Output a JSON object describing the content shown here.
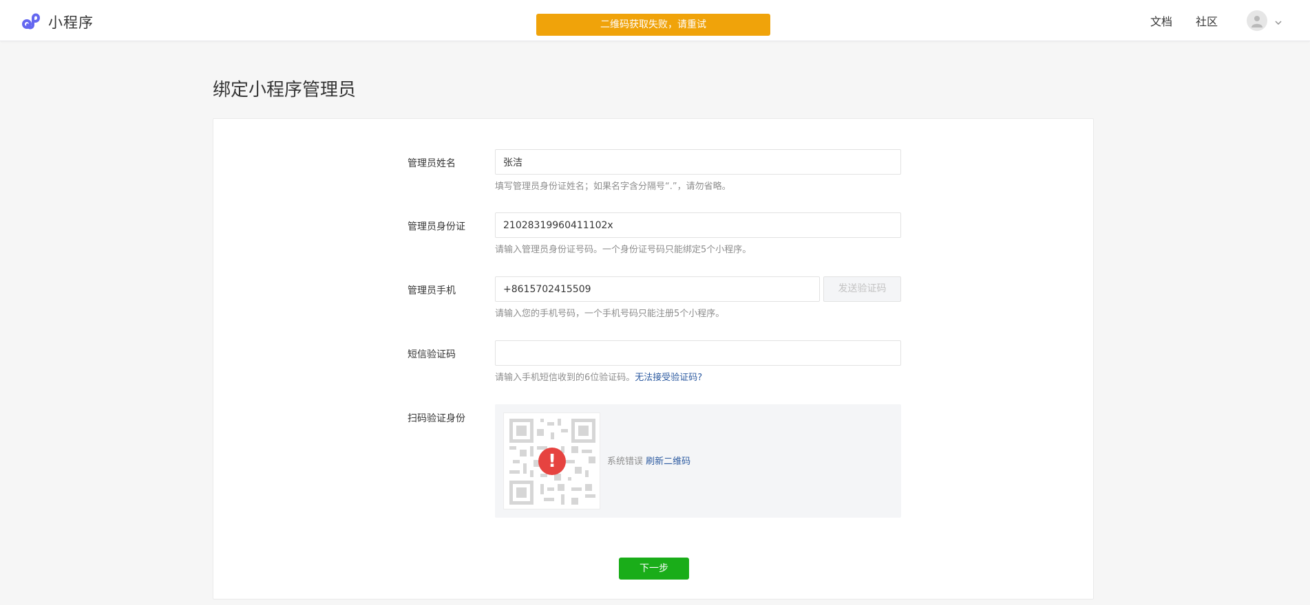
{
  "header": {
    "app_name": "小程序",
    "toast": "二维码获取失败，请重试",
    "nav": [
      {
        "label": "文档"
      },
      {
        "label": "社区"
      }
    ],
    "logo_icon": "miniprogram-logo-icon",
    "avatar_icon": "user-avatar-icon",
    "menu_icon": "chevron-down-icon"
  },
  "page": {
    "title": "绑定小程序管理员"
  },
  "form": {
    "name": {
      "label": "管理员姓名",
      "value": "张洁",
      "hint": "填写管理员身份证姓名；如果名字含分隔号“.”，请勿省略。"
    },
    "id_card": {
      "label": "管理员身份证",
      "value": "21028319960411102x",
      "hint": "请输入管理员身份证号码。一个身份证号码只能绑定5个小程序。"
    },
    "phone": {
      "label": "管理员手机",
      "value": "+8615702415509",
      "send_code": "发送验证码",
      "hint": "请输入您的手机号码，一个手机号码只能注册5个小程序。"
    },
    "sms_code": {
      "label": "短信验证码",
      "value": "",
      "hint": "请输入手机短信收到的6位验证码。",
      "hint_link": "无法接受验证码?"
    },
    "qr_verify": {
      "label": "扫码验证身份",
      "error_text": "系统错误",
      "refresh_link": "刷新二维码",
      "warning_glyph": "!"
    },
    "next_button": "下一步"
  },
  "colors": {
    "toast": "#f0a30a",
    "primary_button": "#1aad19",
    "link": "#2c5aa0",
    "error": "#e64340",
    "logo": "#6467f0"
  }
}
